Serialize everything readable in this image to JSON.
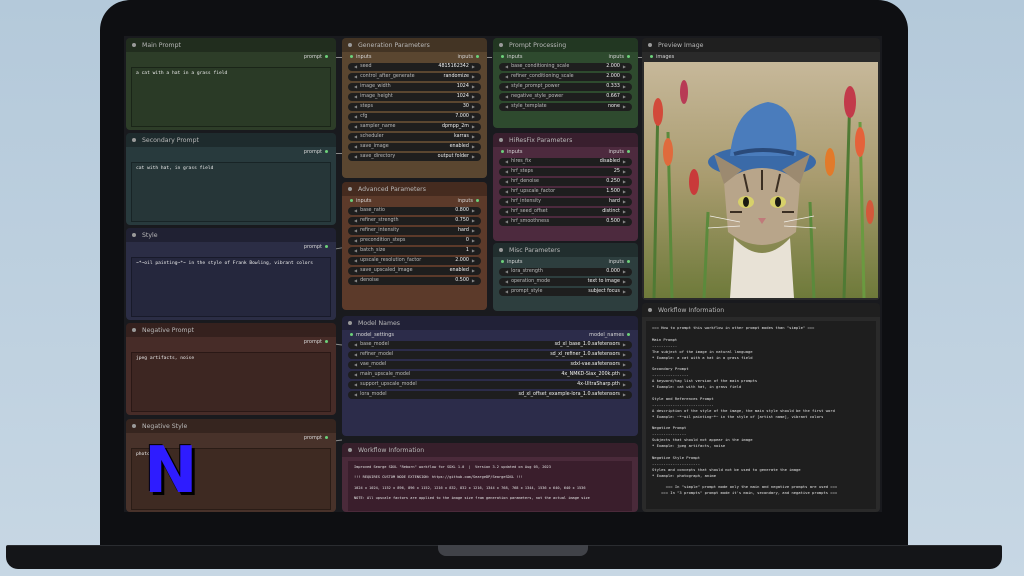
{
  "main_prompt": {
    "title": "Main Prompt",
    "out_label": "prompt",
    "text": "a cat with a hat in a grass field"
  },
  "secondary_prompt": {
    "title": "Secondary Prompt",
    "out_label": "prompt",
    "text": "cat with hat, in grass field"
  },
  "style": {
    "title": "Style",
    "out_label": "prompt",
    "text": "~*~oil painting~*~ in the style of Frank Bowling, vibrant colors"
  },
  "negative_prompt": {
    "title": "Negative Prompt",
    "out_label": "prompt",
    "text": "jpeg artifacts, noise"
  },
  "negative_style": {
    "title": "Negative Style",
    "out_label": "prompt",
    "text": "photo"
  },
  "generation_parameters": {
    "title": "Generation Parameters",
    "in_label": "inputs",
    "out_label": "inputs",
    "rows": [
      {
        "label": "seed",
        "value": "4815162342"
      },
      {
        "label": "control_after_generate",
        "value": "randomize"
      },
      {
        "label": "image_width",
        "value": "1024"
      },
      {
        "label": "image_height",
        "value": "1024"
      },
      {
        "label": "steps",
        "value": "30"
      },
      {
        "label": "cfg",
        "value": "7.000"
      },
      {
        "label": "sampler_name",
        "value": "dpmpp_2m"
      },
      {
        "label": "scheduler",
        "value": "karras"
      },
      {
        "label": "save_image",
        "value": "enabled"
      },
      {
        "label": "save_directory",
        "value": "output folder"
      }
    ]
  },
  "advanced_parameters": {
    "title": "Advanced Parameters",
    "in_label": "inputs",
    "out_label": "inputs",
    "rows": [
      {
        "label": "base_ratio",
        "value": "0.800"
      },
      {
        "label": "refiner_strength",
        "value": "0.750"
      },
      {
        "label": "refiner_intensity",
        "value": "hard"
      },
      {
        "label": "precondition_steps",
        "value": "0"
      },
      {
        "label": "batch_size",
        "value": "1"
      },
      {
        "label": "upscale_resolution_factor",
        "value": "2.000"
      },
      {
        "label": "save_upscaled_image",
        "value": "enabled"
      },
      {
        "label": "denoise",
        "value": "0.500"
      }
    ]
  },
  "prompt_processing": {
    "title": "Prompt Processing",
    "in_label": "inputs",
    "out_label": "inputs",
    "rows": [
      {
        "label": "base_conditioning_scale",
        "value": "2.000"
      },
      {
        "label": "refiner_conditioning_scale",
        "value": "2.000"
      },
      {
        "label": "style_prompt_power",
        "value": "0.333"
      },
      {
        "label": "negative_style_power",
        "value": "0.667"
      },
      {
        "label": "style_template",
        "value": "none"
      }
    ]
  },
  "hires_fix": {
    "title": "HiResFix Parameters",
    "in_label": "inputs",
    "out_label": "inputs",
    "rows": [
      {
        "label": "hires_fix",
        "value": "disabled"
      },
      {
        "label": "hrf_steps",
        "value": "25"
      },
      {
        "label": "hrf_denoise",
        "value": "0.250"
      },
      {
        "label": "hrf_upscale_factor",
        "value": "1.500"
      },
      {
        "label": "hrf_intensity",
        "value": "hard"
      },
      {
        "label": "hrf_seed_offset",
        "value": "distinct"
      },
      {
        "label": "hrf_smoothness",
        "value": "0.500"
      }
    ]
  },
  "misc_parameters": {
    "title": "Misc Parameters",
    "in_label": "inputs",
    "out_label": "inputs",
    "rows": [
      {
        "label": "lora_strength",
        "value": "0.000"
      },
      {
        "label": "operation_mode",
        "value": "text to image"
      },
      {
        "label": "prompt_style",
        "value": "subject focus"
      }
    ]
  },
  "model_names": {
    "title": "Model Names",
    "in_label": "model_settings",
    "out_label": "model_names",
    "rows": [
      {
        "label": "base_model",
        "value": "sd_xl_base_1.0.safetensors"
      },
      {
        "label": "refiner_model",
        "value": "sd_xl_refiner_1.0.safetensors"
      },
      {
        "label": "vae_model",
        "value": "sdxl-vae.safetensors"
      },
      {
        "label": "main_upscale_model",
        "value": "4x_NMKD-Siax_200k.pth"
      },
      {
        "label": "support_upscale_model",
        "value": "4x-UltraSharp.pth"
      },
      {
        "label": "lora_model",
        "value": "sd_xl_offset_example-lora_1.0.safetensors"
      }
    ]
  },
  "workflow_info_center": {
    "title": "Workflow Information",
    "lines": [
      "Improved Searge SDXL \"Reborn\" workflow for SDXL 1.0  |  Version 3.2 updated on Aug 05, 2023",
      "",
      "!!! REQUIRES CUSTOM NODE EXTENSION: https://github.com/SeargeDP/SeargeSDXL !!!",
      "",
      "1024 x 1024, 1152 x 896, 896 x 1152, 1216 x 832, 832 x 1216, 1344 x 768, 768 x 1344, 1536 x 640, 640 x 1536",
      "",
      "NOTE: All upscale factors are applied to the image size from generation parameters, not the actual image size"
    ]
  },
  "preview_image": {
    "title": "Preview Image",
    "in_label": "images"
  },
  "workflow_info_right": {
    "title": "Workflow Information",
    "lines": [
      "=== How to prompt this workflow in other prompt modes than \"simple\" ===",
      "",
      "Main Prompt",
      "-----------",
      "The subject of the image in natural language",
      "* Example: a cat with a hat in a grass field",
      "",
      "Secondary Prompt",
      "----------------",
      "A keyword/tag list version of the main prompts",
      "* Example: cat with hat, in grass field",
      "",
      "Style and References Prompt",
      "---------------------------",
      "A description of the style of the image, the main style should be the first word",
      "* Example: ~*~oil painting~*~ in the style of [artist name], vibrant colors",
      "",
      "Negative Prompt",
      "---------------",
      "Subjects that should not appear in the image",
      "* Example: jpeg artifacts, noise",
      "",
      "Negative Style Prompt",
      "---------------------",
      "Styles and concepts that should not be used to generate the image",
      "* Example: photograph, anime",
      "",
      "      === In \"simple\" prompt mode only the main and negative prompts are used ===",
      "    === In \"3 prompts\" prompt mode it's main, secondary, and negative prompts ==="
    ]
  },
  "logo": {
    "letter": "N"
  }
}
